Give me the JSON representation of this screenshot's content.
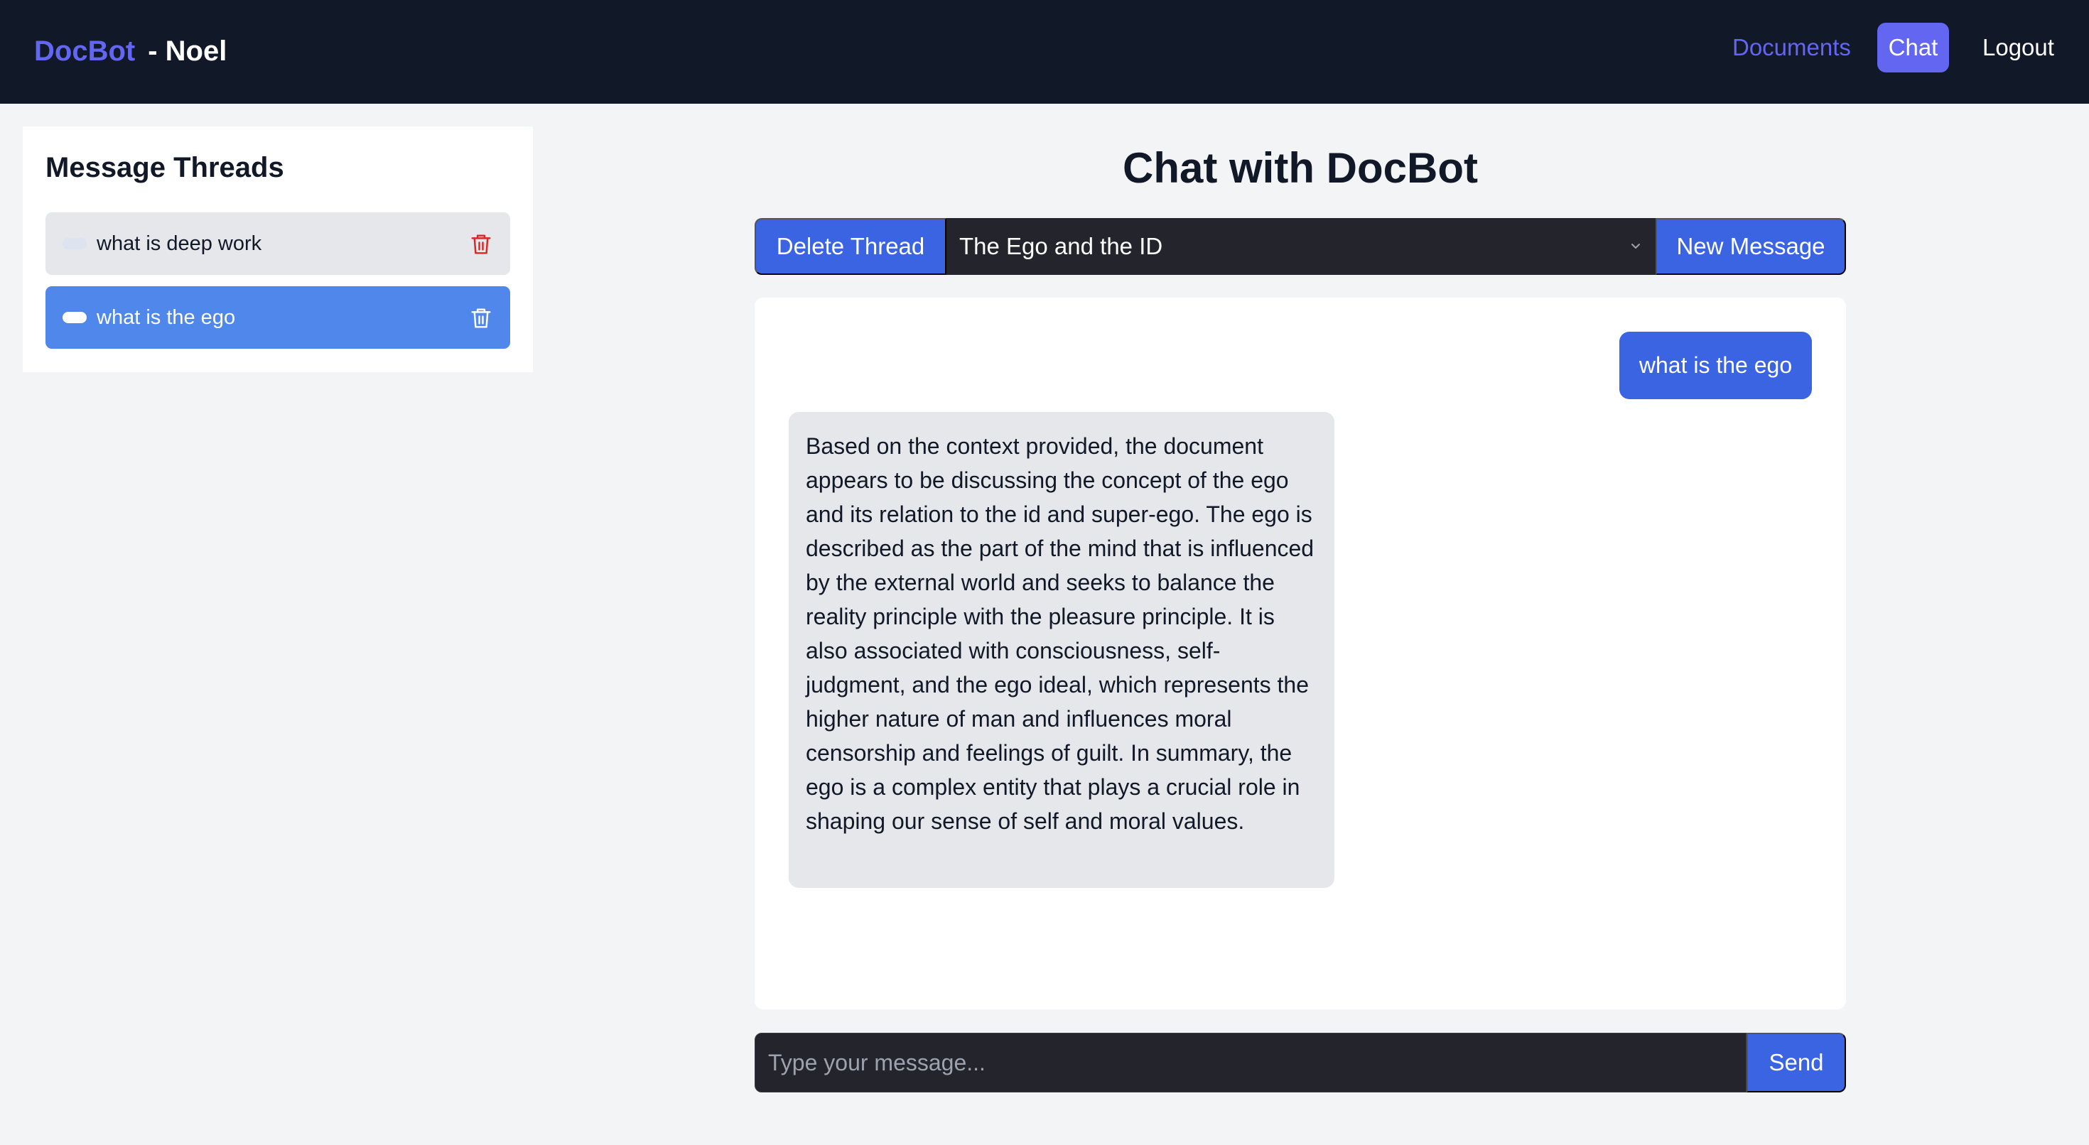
{
  "navbar": {
    "brand": "DocBot",
    "user": "- Noel",
    "links": {
      "documents": "Documents",
      "chat": "Chat",
      "logout": "Logout"
    }
  },
  "sidebar": {
    "title": "Message Threads",
    "threads": [
      {
        "label": "what is deep work",
        "active": false
      },
      {
        "label": "what is the ego",
        "active": true
      }
    ]
  },
  "chat": {
    "title": "Chat with DocBot",
    "delete_label": "Delete Thread",
    "selected_thread": "The Ego and the ID",
    "new_message_label": "New Message",
    "messages": [
      {
        "role": "user",
        "text": "what is the ego"
      },
      {
        "role": "bot",
        "text": "Based on the context provided, the document appears to be discussing the concept of the ego and its relation to the id and super-ego. The ego is described as the part of the mind that is influenced by the external world and seeks to balance the reality principle with the pleasure principle. It is also associated with consciousness, self-judgment, and the ego ideal, which represents the higher nature of man and influences moral censorship and feelings of guilt. In summary, the ego is a complex entity that plays a crucial role in shaping our sense of self and moral values."
      }
    ],
    "input_placeholder": "Type your message...",
    "input_value": "",
    "send_label": "Send"
  },
  "colors": {
    "navbar_bg": "#111827",
    "accent": "#6366f1",
    "primary_button": "#3b64e3",
    "active_thread": "#4f87ea",
    "delete_icon": "#dc2626"
  },
  "icons": {
    "thread_delete": "trash-icon",
    "select_arrow": "chevron-down-icon"
  }
}
